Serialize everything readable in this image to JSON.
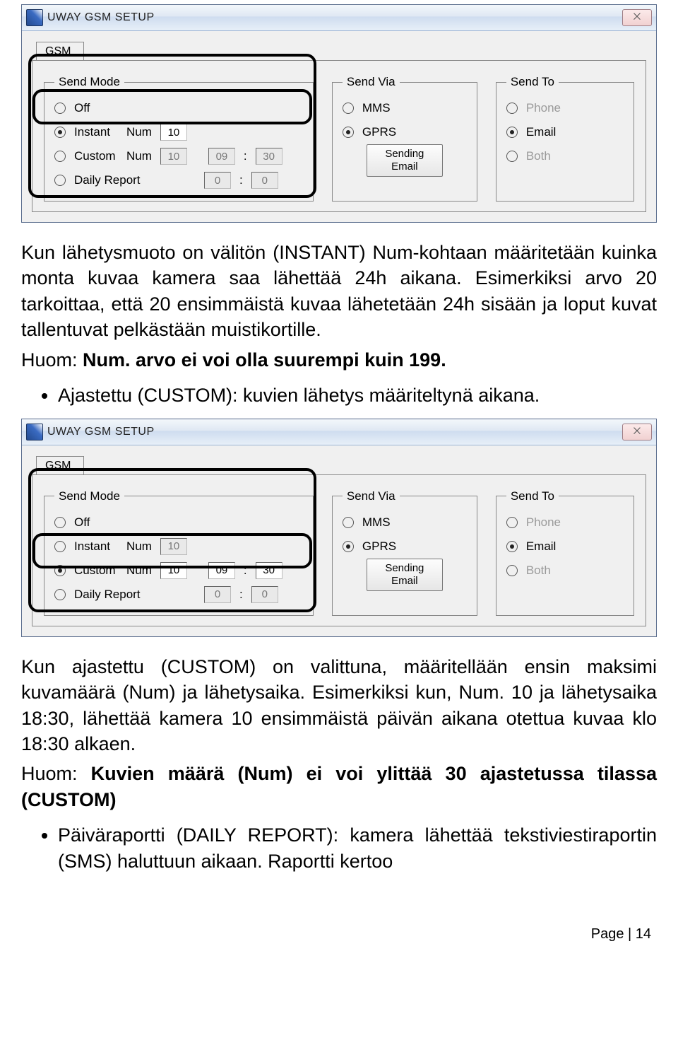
{
  "dialog": {
    "title": "UWAY GSM SETUP",
    "close_glyph": "⨉",
    "tab": "GSM",
    "sendmode": {
      "legend": "Send Mode",
      "off": "Off",
      "instant": "Instant",
      "instant_num_label": "Num",
      "instant_num": "10",
      "custom": "Custom",
      "custom_num_label": "Num",
      "custom_num": "10",
      "custom_h": "09",
      "custom_m": "30",
      "daily": "Daily Report",
      "daily_h": "0",
      "daily_m": "0"
    },
    "sendvia": {
      "legend": "Send Via",
      "mms": "MMS",
      "gprs": "GPRS",
      "button": "Sending Email"
    },
    "sendto": {
      "legend": "Send To",
      "phone": "Phone",
      "email": "Email",
      "both": "Both"
    }
  },
  "text": {
    "p1a": "Kun lähetysmuoto on välitön (INSTANT) Num-kohtaan määritetään kuinka monta kuvaa kamera saa lähettää 24h aikana. Esimerkiksi arvo 20 tarkoittaa, että 20 ensimmäistä kuvaa lähetetään 24h sisään ja loput kuvat tallentuvat pelkästään muistikortille.",
    "p1b_label": "Huom: ",
    "p1b_bold": "Num. arvo ei voi olla suurempi kuin 199.",
    "li1": "Ajastettu (CUSTOM): kuvien lähetys määriteltynä aikana.",
    "p2": "Kun ajastettu (CUSTOM) on valittuna, määritellään ensin maksimi kuvamäärä (Num) ja lähetysaika. Esimerkiksi kun, Num. 10 ja lähetysaika 18:30, lähettää kamera 10 ensimmäistä päivän aikana otettua kuvaa klo 18:30 alkaen.",
    "p3_label": "Huom: ",
    "p3_bold": "Kuvien määrä (Num) ei voi ylittää 30 ajastetussa tilassa (CUSTOM)",
    "li2": "Päiväraportti (DAILY REPORT): kamera lähettää tekstiviestiraportin (SMS) haluttuun aikaan. Raportti kertoo",
    "footer": "Page | 14"
  }
}
